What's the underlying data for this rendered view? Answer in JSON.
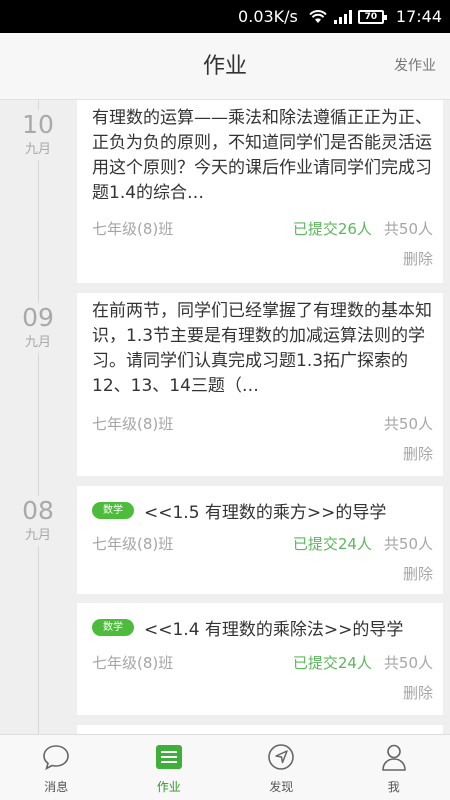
{
  "status_bar": {
    "speed": "0.03K/s",
    "battery": "70",
    "time": "17:44"
  },
  "header": {
    "title": "作业",
    "action": "发作业"
  },
  "homework": [
    {
      "day": "10",
      "month": "九月",
      "text": "有理数的运算——乘法和除法遵循正正为正、正负为负的原则，不知道同学们是否能灵活运用这个原则？今天的课后作业请同学们完成习题1.4的综合…",
      "class_name": "七年级(8)班",
      "submitted": "已提交26人",
      "total": "共50人",
      "delete": "删除"
    },
    {
      "day": "09",
      "month": "九月",
      "text": "在前两节，同学们已经掌握了有理数的基本知识，1.3节主要是有理数的加减运算法则的学习。请同学们认真完成习题1.3拓广探索的12、13、14三题（…",
      "class_name": "七年级(8)班",
      "submitted": "",
      "total": "共50人",
      "delete": "删除"
    },
    {
      "day": "08",
      "month": "九月",
      "tag": "数学",
      "title": "<<1.5 有理数的乘方>>的导学",
      "class_name": "七年级(8)班",
      "submitted": "已提交24人",
      "total": "共50人",
      "delete": "删除"
    },
    {
      "tag": "数学",
      "title": "<<1.4 有理数的乘除法>>的导学",
      "class_name": "七年级(8)班",
      "submitted": "已提交24人",
      "total": "共50人",
      "delete": "删除"
    }
  ],
  "nav": {
    "items": [
      {
        "label": "消息",
        "icon": "chat-bubble-icon"
      },
      {
        "label": "作业",
        "icon": "homework-list-icon"
      },
      {
        "label": "发现",
        "icon": "compass-icon"
      },
      {
        "label": "我",
        "icon": "person-icon"
      }
    ],
    "active_color": "#2e9a2a"
  }
}
